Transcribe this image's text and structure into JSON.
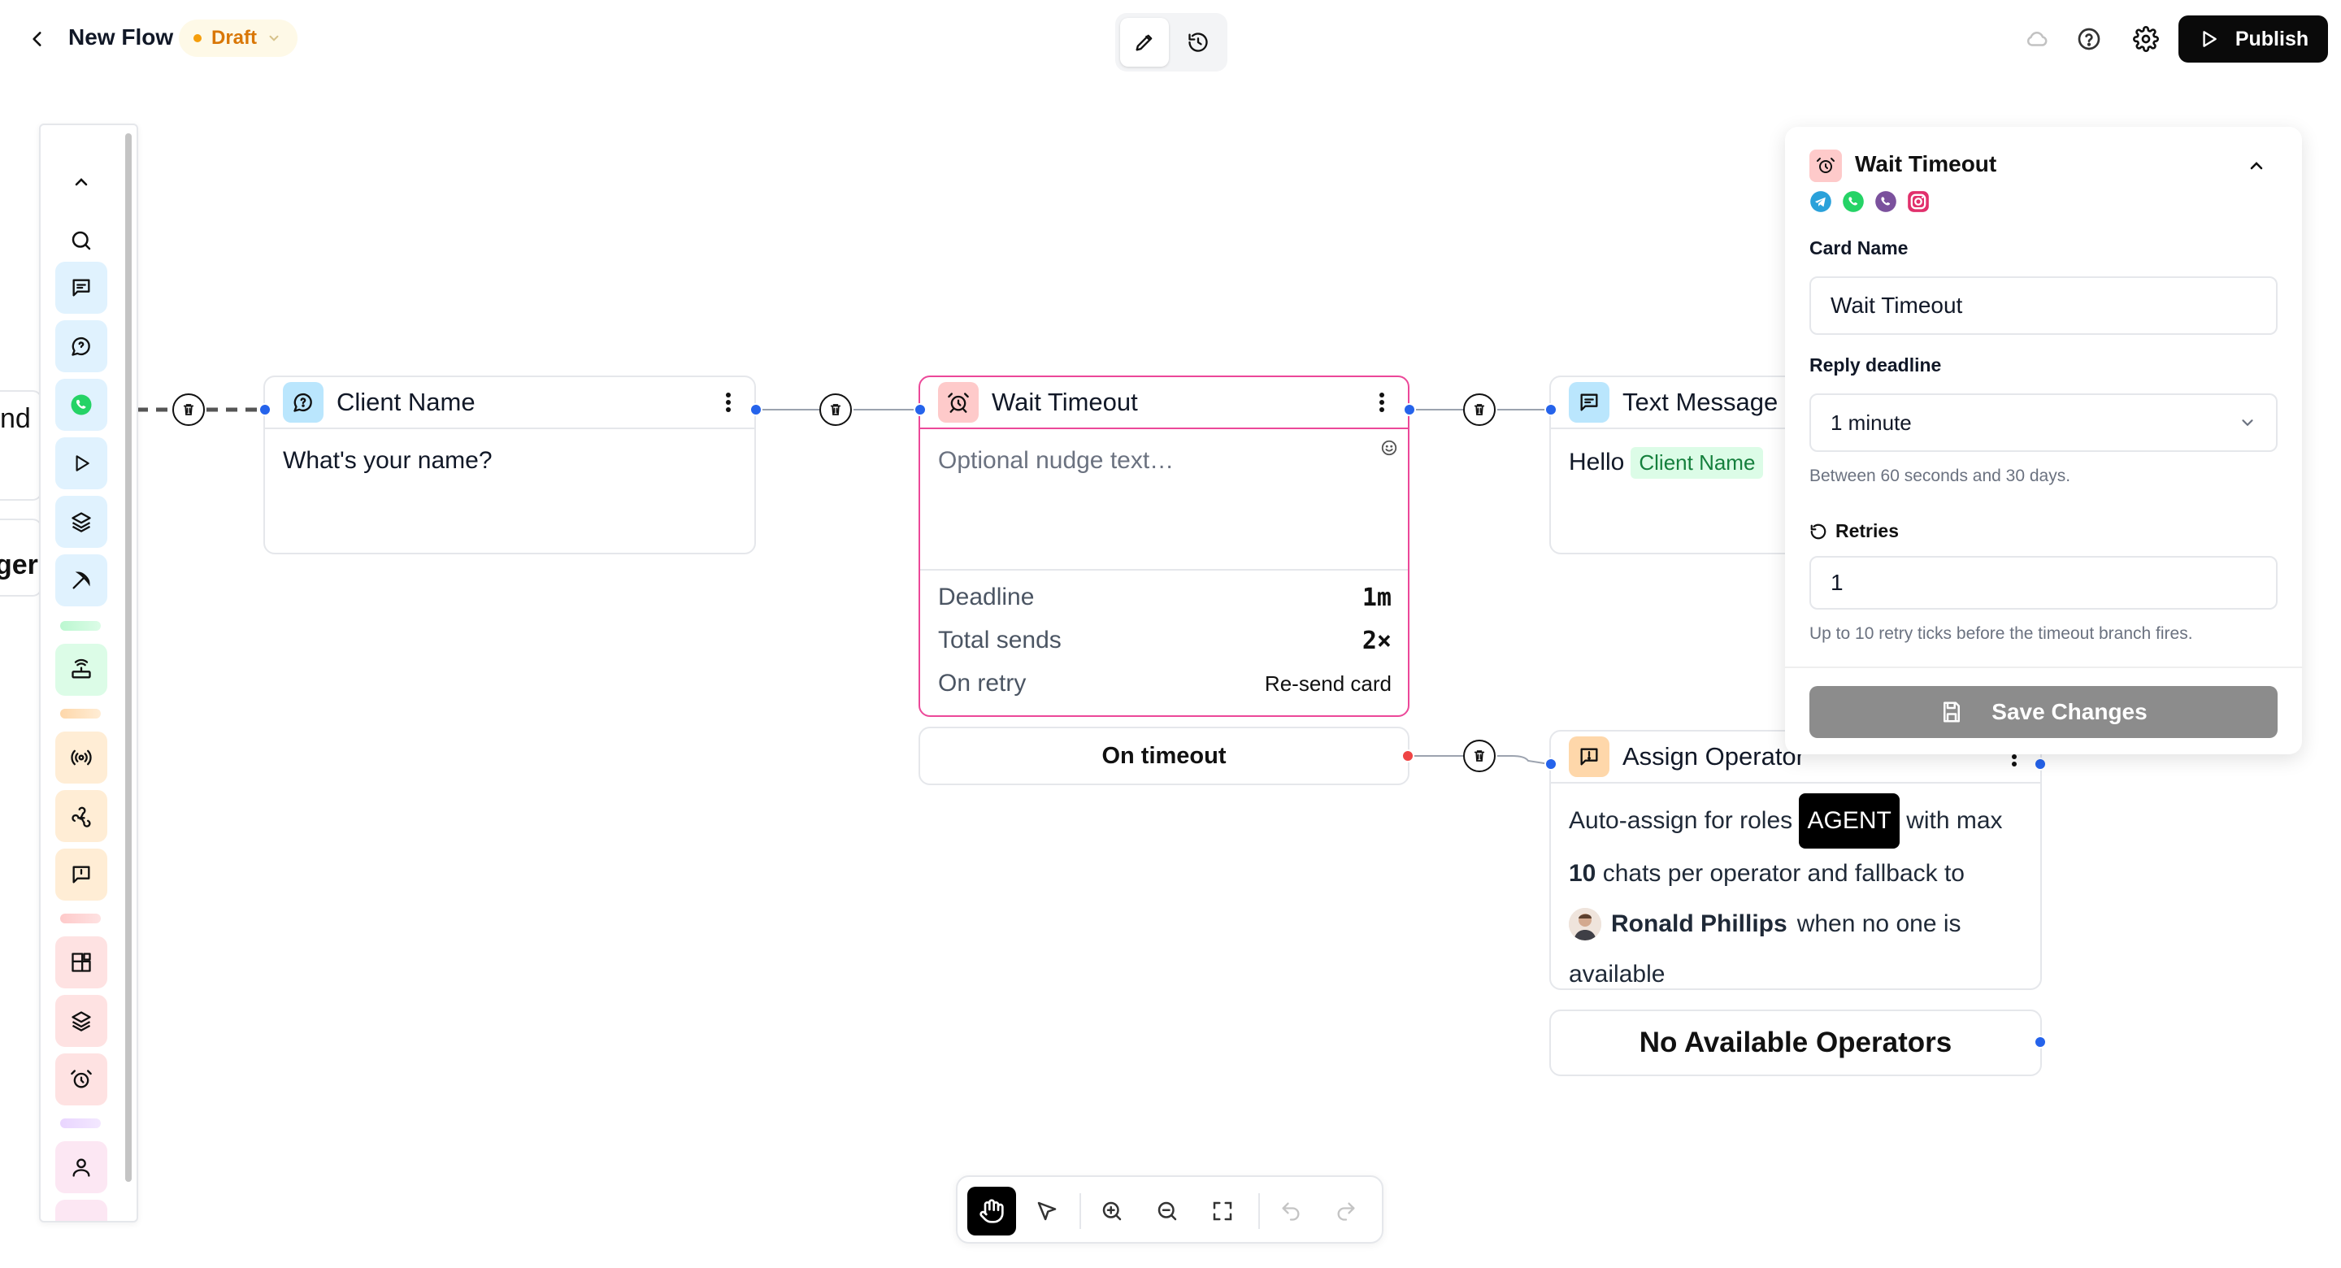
{
  "header": {
    "title": "New Flow",
    "status": "Draft",
    "publish_label": "Publish"
  },
  "icons": {
    "back": "chevron-left-icon",
    "edit_mode": "pencil-icon",
    "history_mode": "history-icon",
    "cloud": "cloud-icon",
    "help": "help-circle-icon",
    "settings": "gear-icon",
    "publish": "play-icon"
  },
  "colors": {
    "accent_blue": "#2563eb",
    "selected_card_border": "#ec4899",
    "draft_text": "#d97706",
    "draft_dot": "#f59e0b",
    "timeout_port": "#ef4444"
  },
  "canvas": {
    "cropped_left_texts": [
      "nd",
      "ger"
    ],
    "cards": {
      "client_name": {
        "title": "Client Name",
        "body": "What's your name?"
      },
      "wait_timeout": {
        "title": "Wait Timeout",
        "placeholder": "Optional nudge text…",
        "rows": [
          {
            "label": "Deadline",
            "value": "1m"
          },
          {
            "label": "Total sends",
            "value": "2×"
          },
          {
            "label": "On retry",
            "value": "Re-send card"
          }
        ],
        "timeout_branch": "On timeout"
      },
      "text_message": {
        "title": "Text Message",
        "body_prefix": "Hello",
        "variable": "Client Name"
      },
      "assign_operator": {
        "title": "Assign Operator",
        "line1_prefix": "Auto-assign for roles",
        "role": "AGENT",
        "line1_suffix": "with max",
        "max_chats": "10",
        "line2_suffix": "chats per operator and fallback to",
        "fallback_user": "Ronald Phillips",
        "line3_suffix": "when no one is",
        "line4": "available",
        "fallback_branch": "No Available Operators"
      }
    }
  },
  "panel": {
    "title": "Wait Timeout",
    "channels": [
      "telegram-icon",
      "whatsapp-icon",
      "viber-icon",
      "instagram-icon"
    ],
    "card_name_label": "Card Name",
    "card_name_value": "Wait Timeout",
    "reply_deadline_label": "Reply deadline",
    "reply_deadline_value": "1 minute",
    "reply_deadline_hint": "Between 60 seconds and 30 days.",
    "retries_label": "Retries",
    "retries_value": "1",
    "retries_hint": "Up to 10 retry ticks before the timeout branch fires.",
    "save_label": "Save Changes"
  },
  "bottom_toolbar": {
    "tools": [
      "hand-icon",
      "pointer-icon",
      "zoom-in-icon",
      "zoom-out-icon",
      "fit-screen-icon",
      "undo-icon",
      "redo-icon"
    ],
    "active_tool": "hand-icon"
  }
}
